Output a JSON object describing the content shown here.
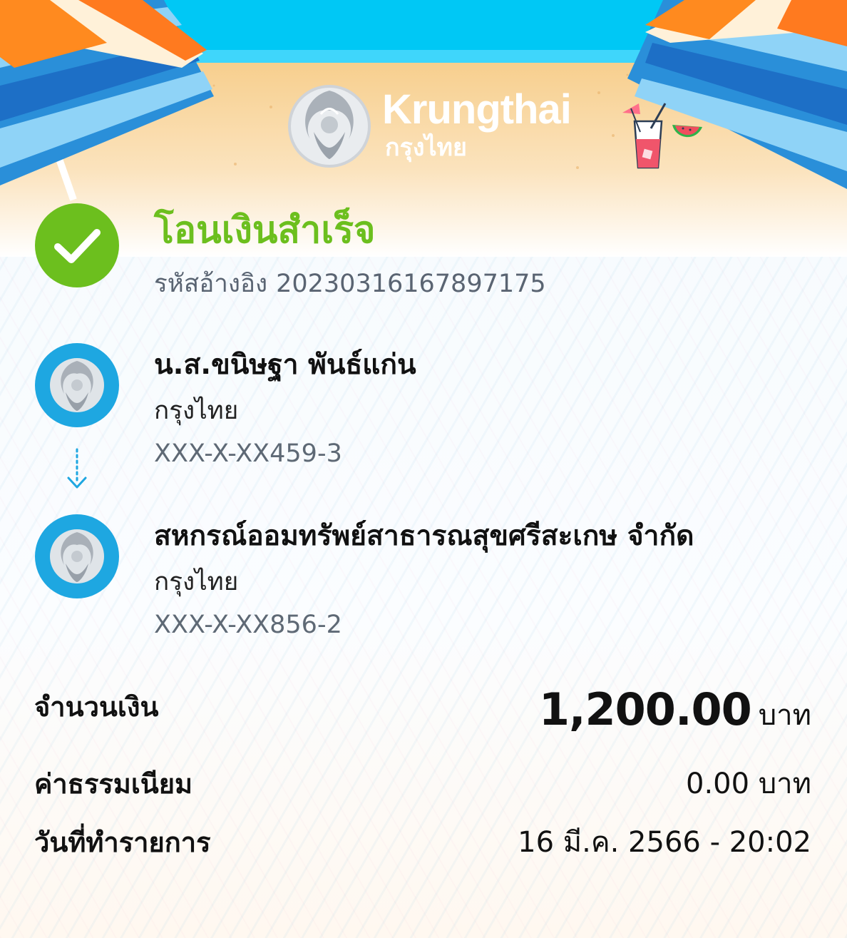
{
  "brand": {
    "name_en": "Krungthai",
    "name_th": "กรุงไทย"
  },
  "status": {
    "title": "โอนเงินสำเร็จ",
    "reference_label": "รหัสอ้างอิง",
    "reference_number": "20230316167897175"
  },
  "sender": {
    "name": "น.ส.ขนิษฐา พันธ์แก่น",
    "bank": "กรุงไทย",
    "account": "XXX-X-XX459-3"
  },
  "receiver": {
    "name": "สหกรณ์ออมทรัพย์สาธารณสุขศรีสะเกษ จำกัด",
    "bank": "กรุงไทย",
    "account": "XXX-X-XX856-2"
  },
  "details": {
    "amount_label": "จำนวนเงิน",
    "amount_value": "1,200.00",
    "amount_unit": "บาท",
    "fee_label": "ค่าธรรมเนียม",
    "fee_value": "0.00 บาท",
    "date_label": "วันที่ทำรายการ",
    "date_value": "16 มี.ค. 2566 - 20:02"
  },
  "colors": {
    "success_green": "#6cbf1e",
    "bank_blue": "#1ea7e1",
    "sky": "#00c8f5",
    "sand": "#f7cf8e"
  },
  "icons": {
    "status": "check-circle-icon",
    "bank_logo": "krungthai-bird-icon",
    "transfer_arrow": "dotted-arrow-down-icon",
    "decor_drink": "cocktail-icon"
  }
}
